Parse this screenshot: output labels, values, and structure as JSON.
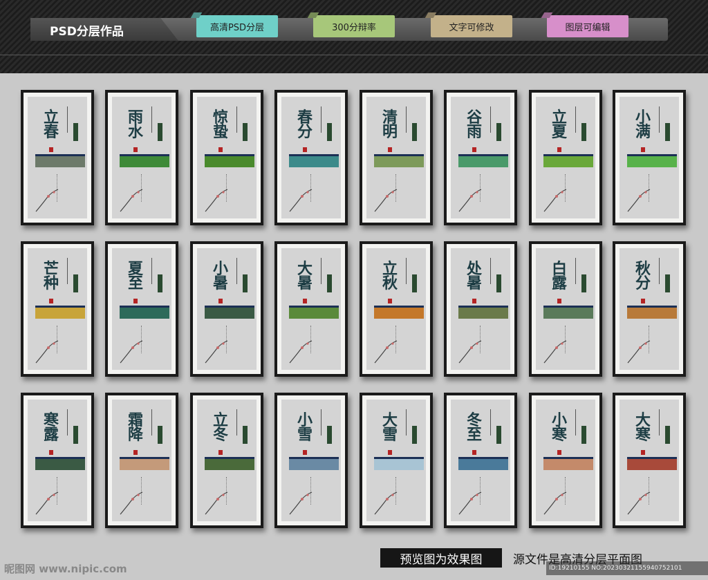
{
  "header": {
    "title": "PSD分层作品",
    "badges": [
      "高清PSD分层",
      "300分辩率",
      "文字可修改",
      "图层可编辑"
    ],
    "badge_colors": [
      "#6fd0c8",
      "#a7c77a",
      "#c3b18a",
      "#d78fca"
    ]
  },
  "frames": [
    {
      "term": "立春",
      "stripe": "#6d7a6a"
    },
    {
      "term": "雨水",
      "stripe": "#3e8a38"
    },
    {
      "term": "惊蛰",
      "stripe": "#4a8a2c"
    },
    {
      "term": "春分",
      "stripe": "#3c8a8a"
    },
    {
      "term": "清明",
      "stripe": "#7d9a5a"
    },
    {
      "term": "谷雨",
      "stripe": "#4a9a6a"
    },
    {
      "term": "立夏",
      "stripe": "#6aa83a"
    },
    {
      "term": "小满",
      "stripe": "#58b24a"
    },
    {
      "term": "芒种",
      "stripe": "#c8a43a"
    },
    {
      "term": "夏至",
      "stripe": "#2d6a5a"
    },
    {
      "term": "小暑",
      "stripe": "#3a5a44"
    },
    {
      "term": "大暑",
      "stripe": "#5a8a3a"
    },
    {
      "term": "立秋",
      "stripe": "#c4782a"
    },
    {
      "term": "处暑",
      "stripe": "#6a7a4a"
    },
    {
      "term": "白露",
      "stripe": "#5a7a5a"
    },
    {
      "term": "秋分",
      "stripe": "#b87a3a"
    },
    {
      "term": "寒露",
      "stripe": "#3a5a44"
    },
    {
      "term": "霜降",
      "stripe": "#c49a7a"
    },
    {
      "term": "立冬",
      "stripe": "#4a6a3a"
    },
    {
      "term": "小雪",
      "stripe": "#6a8aa4"
    },
    {
      "term": "大雪",
      "stripe": "#a8c4d4"
    },
    {
      "term": "冬至",
      "stripe": "#4a7a9a"
    },
    {
      "term": "小寒",
      "stripe": "#c48a6a"
    },
    {
      "term": "大寒",
      "stripe": "#a84a3a"
    }
  ],
  "footer": {
    "box_text": "预览图为效果图",
    "text": "源文件是高清分层平面图",
    "watermark": "昵图网 www.nipic.com",
    "id_text": "ID:19210155 NO:20230321155940752101"
  }
}
